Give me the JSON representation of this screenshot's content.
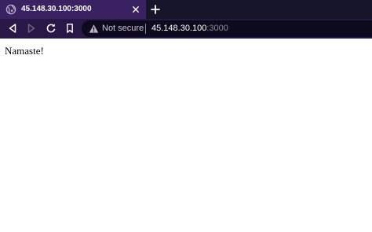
{
  "tab": {
    "title": "45.148.30.100:3000",
    "favicon": "globe-icon",
    "close_icon": "close-icon"
  },
  "toolbar": {
    "new_tab_icon": "plus-icon",
    "back_icon": "back-icon",
    "forward_icon": "forward-icon",
    "reload_icon": "reload-icon",
    "bookmark_icon": "bookmark-icon"
  },
  "omnibox": {
    "security_icon": "warning-icon",
    "security_label": "Not secure",
    "url_host": "45.148.30.100",
    "url_port": ":3000"
  },
  "page": {
    "text": "Namaste!"
  },
  "colors": {
    "tab_active": "#3a2262",
    "tabstrip": "#16152a",
    "toolbar": "#291748",
    "omnibox": "#0d0a1d",
    "url_host": "#ffffff",
    "url_port": "#8d879b"
  }
}
